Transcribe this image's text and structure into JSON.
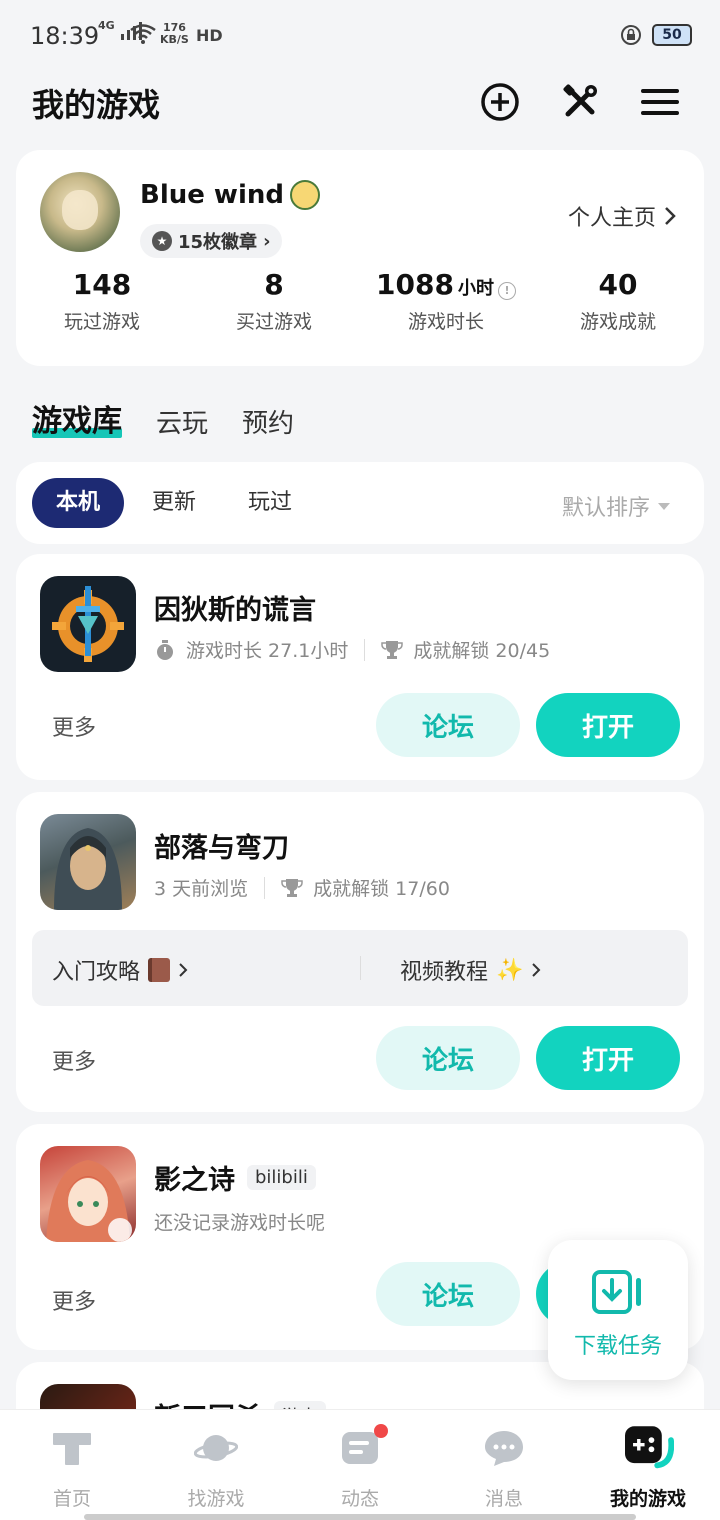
{
  "status_bar": {
    "time": "18:39",
    "signal": "4G",
    "net_speed": "176",
    "net_unit": "KB/S",
    "hd": "HD",
    "battery": "50"
  },
  "header": {
    "title": "我的游戏",
    "icons": [
      "add-circle-icon",
      "tools-icon",
      "menu-icon"
    ]
  },
  "profile": {
    "username": "Blue wind",
    "badges": "15枚徽章",
    "homepage_link": "个人主页",
    "stats": [
      {
        "value": "148",
        "unit": "",
        "label": "玩过游戏"
      },
      {
        "value": "8",
        "unit": "",
        "label": "买过游戏"
      },
      {
        "value": "1088",
        "unit": "小时",
        "label": "游戏时长"
      },
      {
        "value": "40",
        "unit": "",
        "label": "游戏成就"
      }
    ]
  },
  "tabs": [
    "游戏库",
    "云玩",
    "预约"
  ],
  "filters": {
    "chips": [
      "本机",
      "更新",
      "玩过"
    ],
    "sort": "默认排序"
  },
  "games": [
    {
      "title": "因狄斯的谎言",
      "playtime": "游戏时长 27.1小时",
      "achievement": "成就解锁 20/45",
      "more": "更多",
      "forum": "论坛",
      "open": "打开"
    },
    {
      "title": "部落与弯刀",
      "browsed": "3 天前浏览",
      "achievement": "成就解锁 17/60",
      "guide": "入门攻略",
      "video": "视频教程",
      "more": "更多",
      "forum": "论坛",
      "open": "打开"
    },
    {
      "title": "影之诗",
      "tag": "bilibili",
      "note": "还没记录游戏时长呢",
      "more": "更多",
      "forum": "论坛"
    },
    {
      "title": "新三国杀",
      "tag": "游卡"
    }
  ],
  "float_download": {
    "label": "下载任务"
  },
  "bottom_nav": [
    {
      "label": "首页",
      "icon": "home-icon"
    },
    {
      "label": "找游戏",
      "icon": "planet-icon"
    },
    {
      "label": "动态",
      "icon": "feed-icon"
    },
    {
      "label": "消息",
      "icon": "message-icon"
    },
    {
      "label": "我的游戏",
      "icon": "gamepad-icon"
    }
  ],
  "colors": {
    "accent": "#12d3bf",
    "accent_text": "#12b9ac",
    "chip_active": "#1d2a73",
    "notify": "#f04848"
  }
}
